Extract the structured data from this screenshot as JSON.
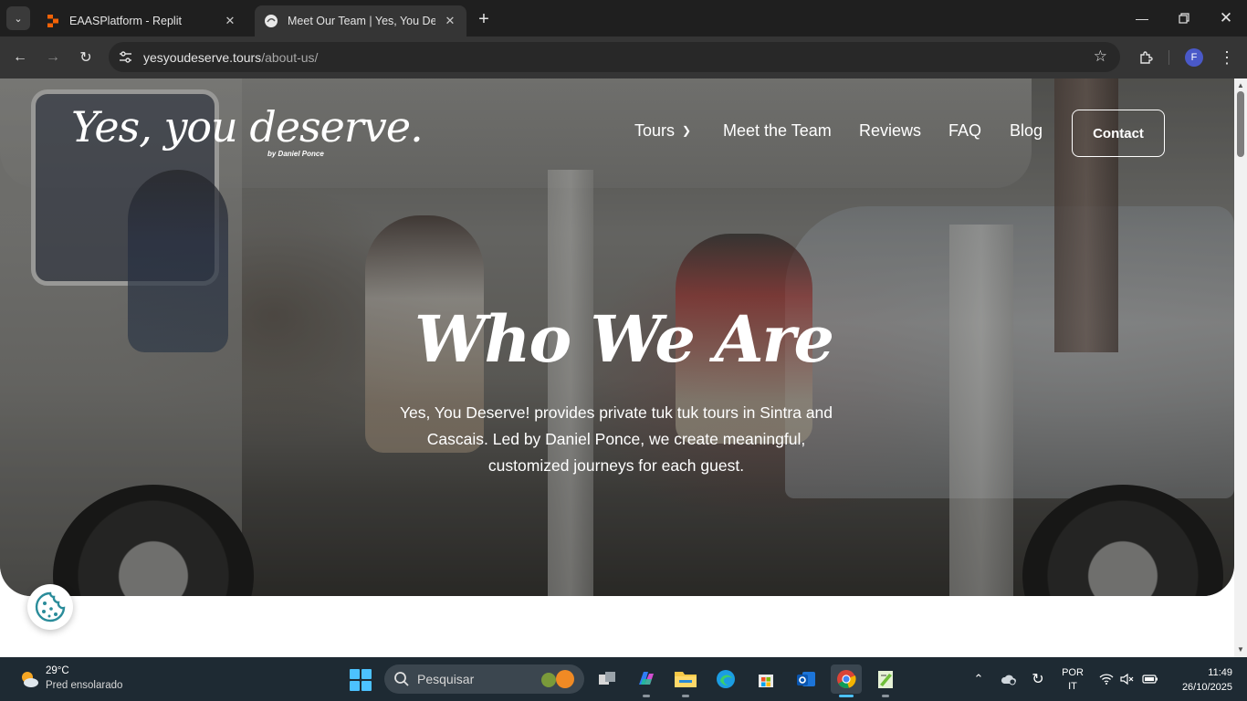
{
  "browser": {
    "tabs": [
      {
        "title": "EAASPlatform - Replit",
        "icon": "replit-icon",
        "active": false
      },
      {
        "title": "Meet Our Team | Yes, You Deserve",
        "icon": "site-favicon",
        "active": true
      }
    ],
    "url_domain": "yesyoudeserve.tours",
    "url_path": "/about-us/",
    "profile_initial": "F"
  },
  "site": {
    "logo_text": "Yes, you deserve.",
    "logo_byline": "by Daniel Ponce",
    "nav": [
      "Tours",
      "Meet the Team",
      "Reviews",
      "FAQ",
      "Blog"
    ],
    "contact_label": "Contact"
  },
  "hero": {
    "title": "Who We Are",
    "description": "Yes, You Deserve! provides private tuk tuk tours in Sintra and Cascais. Led by Daniel Ponce, we create meaningful, customized journeys for each guest."
  },
  "taskbar": {
    "weather_temp": "29°C",
    "weather_desc": "Pred ensolarado",
    "search_placeholder": "Pesquisar",
    "lang_line1": "POR",
    "lang_line2": "IT",
    "time": "11:49",
    "date": "26/10/2025",
    "apps": [
      "task-view",
      "m365-copilot",
      "file-explorer",
      "edge",
      "microsoft-store",
      "outlook",
      "chrome",
      "notepad-plus"
    ]
  },
  "colors": {
    "tabstrip": "#1f1f1f",
    "toolbar": "#353535",
    "taskbar": "#1e2a33",
    "accent": "#4cc2ff",
    "cookie_teal": "#2a8c9a"
  }
}
